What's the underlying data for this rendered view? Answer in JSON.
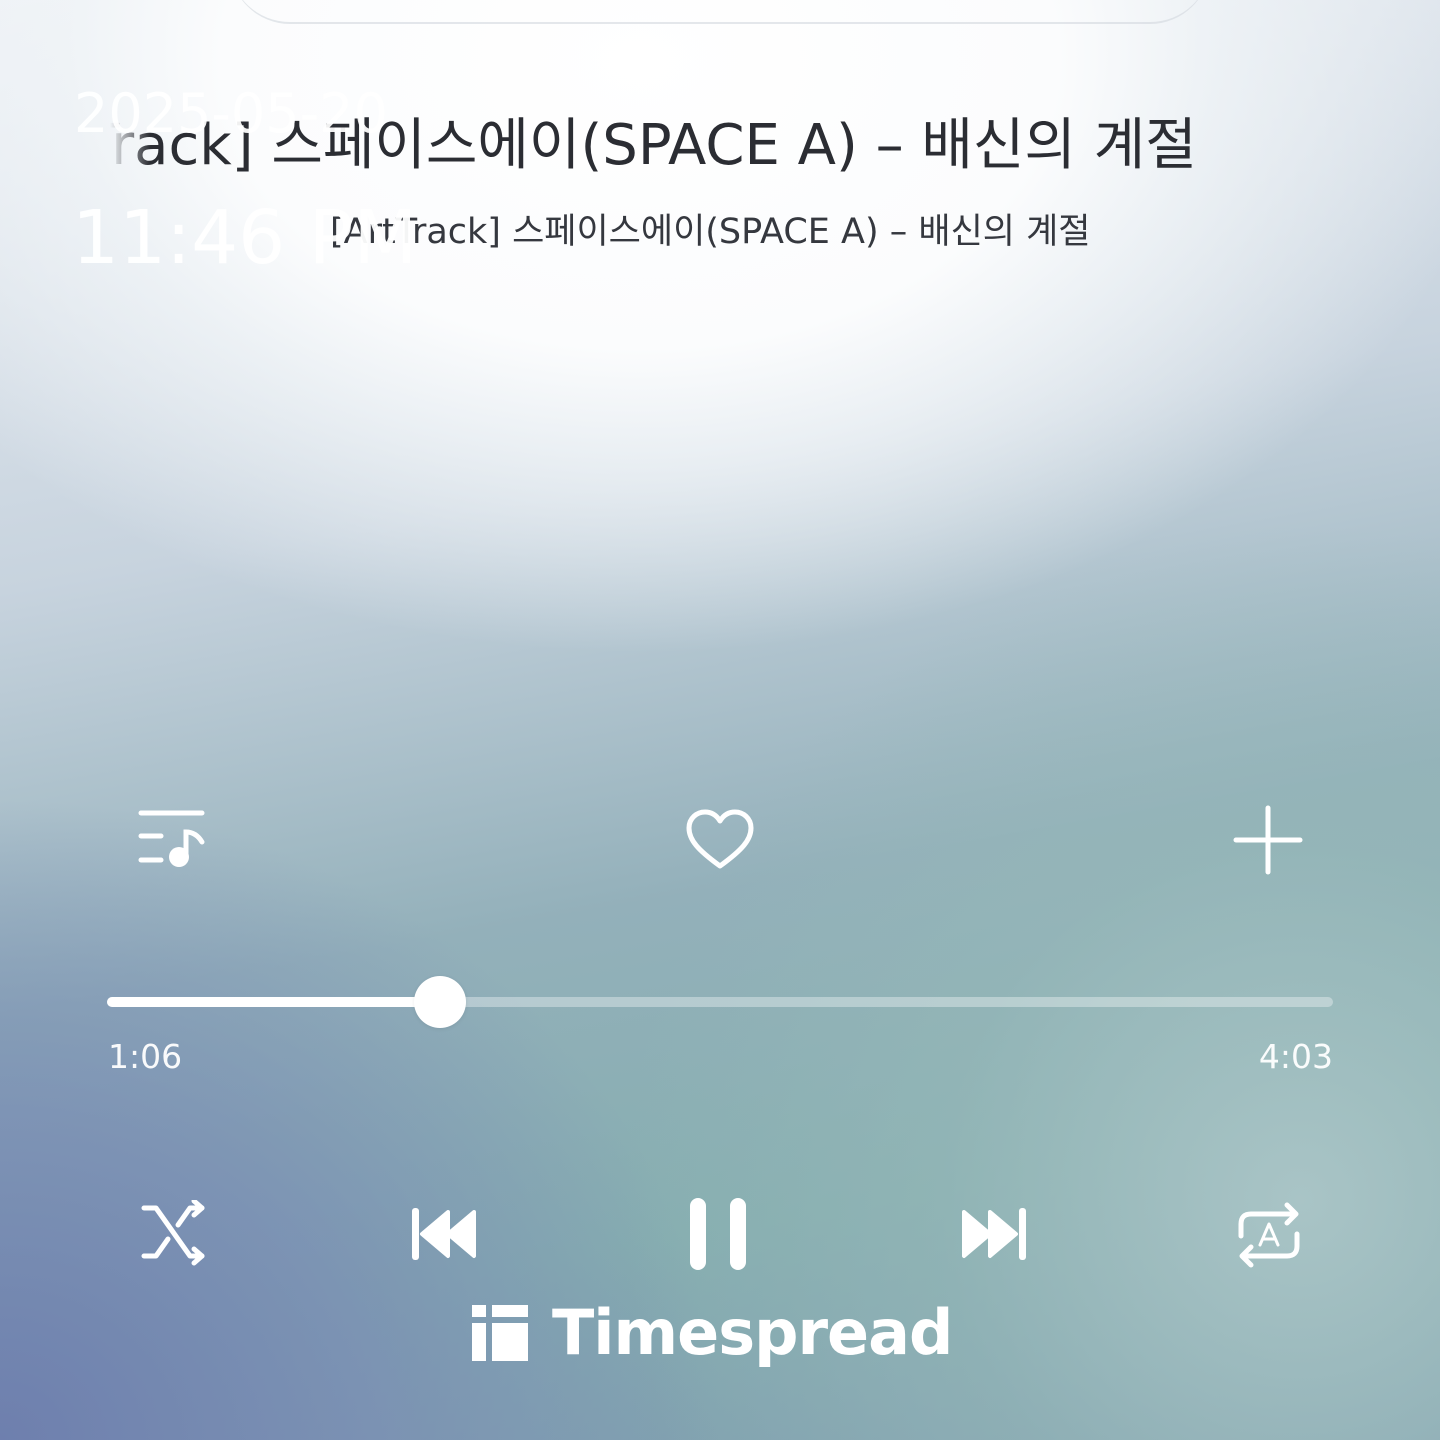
{
  "status_overlay": {
    "date": "2025-05-20",
    "time": "11:46 PM"
  },
  "track": {
    "title": "[ArtTrack] 스페이스에이(SPACE A) – 배신의 계절",
    "subtitle": "[ArtTrack] 스페이스에이(SPACE A) – 배신의 계절"
  },
  "actions": {
    "playlist_icon": "playlist-music-icon",
    "like_icon": "heart-outline-icon",
    "add_icon": "plus-icon"
  },
  "progress": {
    "elapsed": "1:06",
    "total": "4:03",
    "fraction": 0.272
  },
  "controls": {
    "shuffle_icon": "shuffle-icon",
    "previous_icon": "skip-previous-icon",
    "play_pause_icon": "pause-icon",
    "next_icon": "skip-next-icon",
    "repeat_icon": "repeat-a-icon"
  },
  "watermark": {
    "brand": "Timespread"
  },
  "colors": {
    "icon": "#ffffff",
    "title_text": "#2b2d33"
  }
}
